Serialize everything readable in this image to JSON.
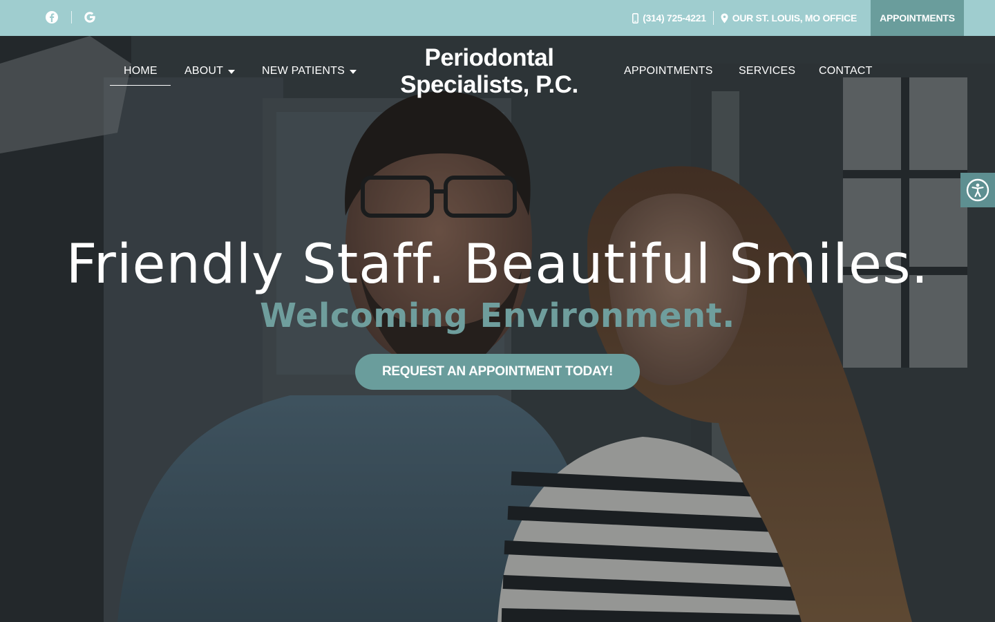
{
  "topbar": {
    "social": [
      {
        "icon": "facebook-icon"
      },
      {
        "icon": "google-icon"
      }
    ],
    "phone": "(314) 725-4221",
    "office": "OUR ST. LOUIS, MO OFFICE",
    "appointments_button": "APPOINTMENTS"
  },
  "nav": {
    "left": [
      "HOME",
      "ABOUT",
      "NEW PATIENTS"
    ],
    "right": [
      "APPOINTMENTS",
      "SERVICES",
      "CONTACT"
    ],
    "logo_line1": "Periodontal",
    "logo_line2": "Specialists, P.C."
  },
  "hero": {
    "headline": "Friendly Staff. Beautiful Smiles.",
    "subline": "Welcoming Environment.",
    "cta": "REQUEST AN APPOINTMENT TODAY!"
  },
  "colors": {
    "topbar_bg": "#9fcdcf",
    "accent": "#6a9d9c",
    "subline": "#6f9e9d"
  },
  "accessibility": {
    "icon": "accessibility-icon"
  }
}
